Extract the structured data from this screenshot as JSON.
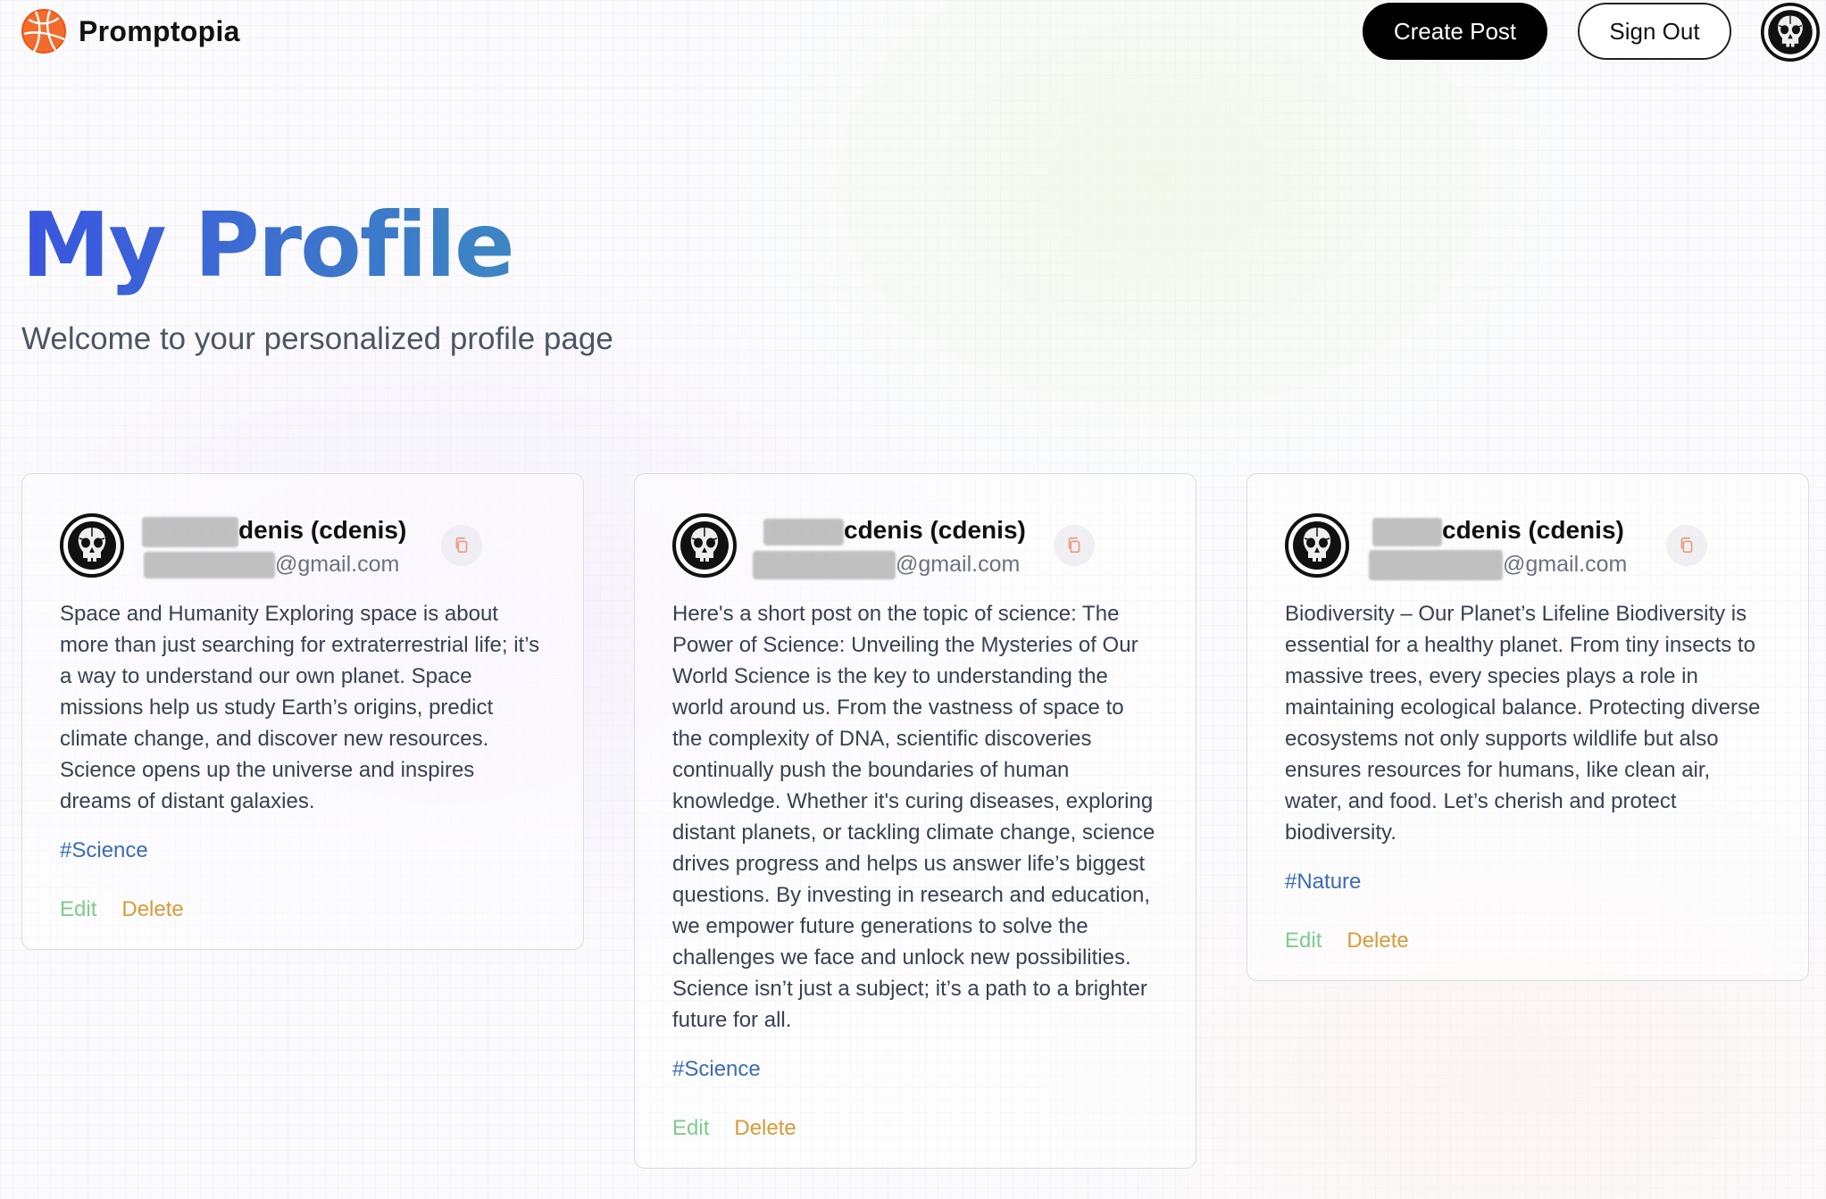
{
  "brand": {
    "name": "Promptopia",
    "logo_icon": "globe-logo-icon"
  },
  "nav": {
    "create_label": "Create Post",
    "signout_label": "Sign Out",
    "avatar_icon": "skull-avatar-icon"
  },
  "header": {
    "title": "My Profile",
    "subtitle": "Welcome to your personalized profile page"
  },
  "colors": {
    "accent_blue": "#3a55e0",
    "edit_green": "#7ecb8f",
    "delete_orange": "#d79b3a",
    "tag_blue": "#3b6ab8"
  },
  "posts": [
    {
      "name_suffix": "denis (cdenis)",
      "email_suffix": "@gmail.com",
      "text": "Space and Humanity Exploring space is about more than just searching for extraterrestrial life; it’s a way to understand our own planet. Space missions help us study Earth’s origins, predict climate change, and discover new resources. Science opens up the universe and inspires dreams of distant galaxies.",
      "tag": "#Science",
      "edit": "Edit",
      "delete": "Delete"
    },
    {
      "name_suffix": "cdenis (cdenis)",
      "email_suffix": "@gmail.com",
      "text": "Here's a short post on the topic of science: The Power of Science: Unveiling the Mysteries of Our World Science is the key to understanding the world around us. From the vastness of space to the complexity of DNA, scientific discoveries continually push the boundaries of human knowledge. Whether it's curing diseases, exploring distant planets, or tackling climate change, science drives progress and helps us answer life’s biggest questions. By investing in research and education, we empower future generations to solve the challenges we face and unlock new possibilities. Science isn’t just a subject; it’s a path to a brighter future for all.",
      "tag": "#Science",
      "edit": "Edit",
      "delete": "Delete"
    },
    {
      "name_suffix": "cdenis (cdenis)",
      "email_suffix": "@gmail.com",
      "text": "Biodiversity – Our Planet’s Lifeline Biodiversity is essential for a healthy planet. From tiny insects to massive trees, every species plays a role in maintaining ecological balance. Protecting diverse ecosystems not only supports wildlife but also ensures resources for humans, like clean air, water, and food. Let’s cherish and protect biodiversity.",
      "tag": "#Nature",
      "edit": "Edit",
      "delete": "Delete"
    }
  ]
}
